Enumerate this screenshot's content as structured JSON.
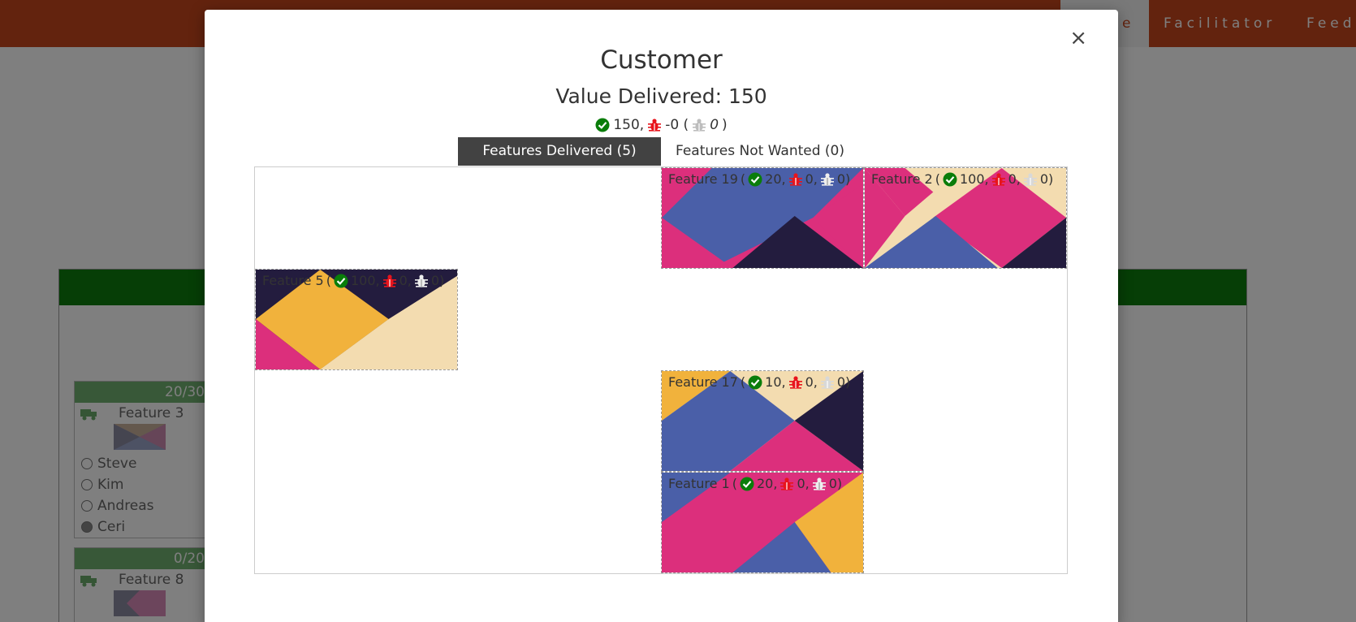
{
  "nav": {
    "partial_label": "e",
    "facilitator_label": "Facilitator",
    "feedback_label": "Feed"
  },
  "cards": [
    {
      "score": "20/30",
      "feature": "Feature 3",
      "people": [
        "Steve",
        "Kim",
        "Andreas",
        "Ceri"
      ],
      "checked_index": 3
    },
    {
      "score": "0/20",
      "feature": "Feature 8"
    }
  ],
  "modal": {
    "title": "Customer",
    "value_delivered": "Value Delivered: 150",
    "summary": {
      "ok": "150,",
      "bug": "-0 (",
      "ignored": "0",
      "close_paren": ")"
    },
    "tabs": [
      {
        "label": "Features Delivered (5)",
        "active": true
      },
      {
        "label": "Features Not Wanted (0)",
        "active": false
      }
    ],
    "features": [
      {
        "name": "Feature 19",
        "ok": "20,",
        "bug": "0,",
        "ignored": "0)"
      },
      {
        "name": "Feature 2",
        "ok": "100,",
        "bug": "0,",
        "ignored": "0)"
      },
      {
        "name": "Feature 5",
        "ok": "100,",
        "bug": "0,",
        "ignored": "0)"
      },
      {
        "name": "Feature 17",
        "ok": "10,",
        "bug": "0,",
        "ignored": "0)"
      },
      {
        "name": "Feature 1",
        "ok": "20,",
        "bug": "0,",
        "ignored": "0)"
      }
    ]
  },
  "colors": {
    "brand": "#c6461c",
    "ok_green": "#0a7d0a",
    "bug_red": "#e8141c",
    "ignored_grey": "#bdbdbd",
    "pink": "#dc2f7c",
    "blue": "#4a5fa8",
    "navy": "#231c3e",
    "gold": "#f1b23c",
    "cream": "#f3dcb0"
  }
}
